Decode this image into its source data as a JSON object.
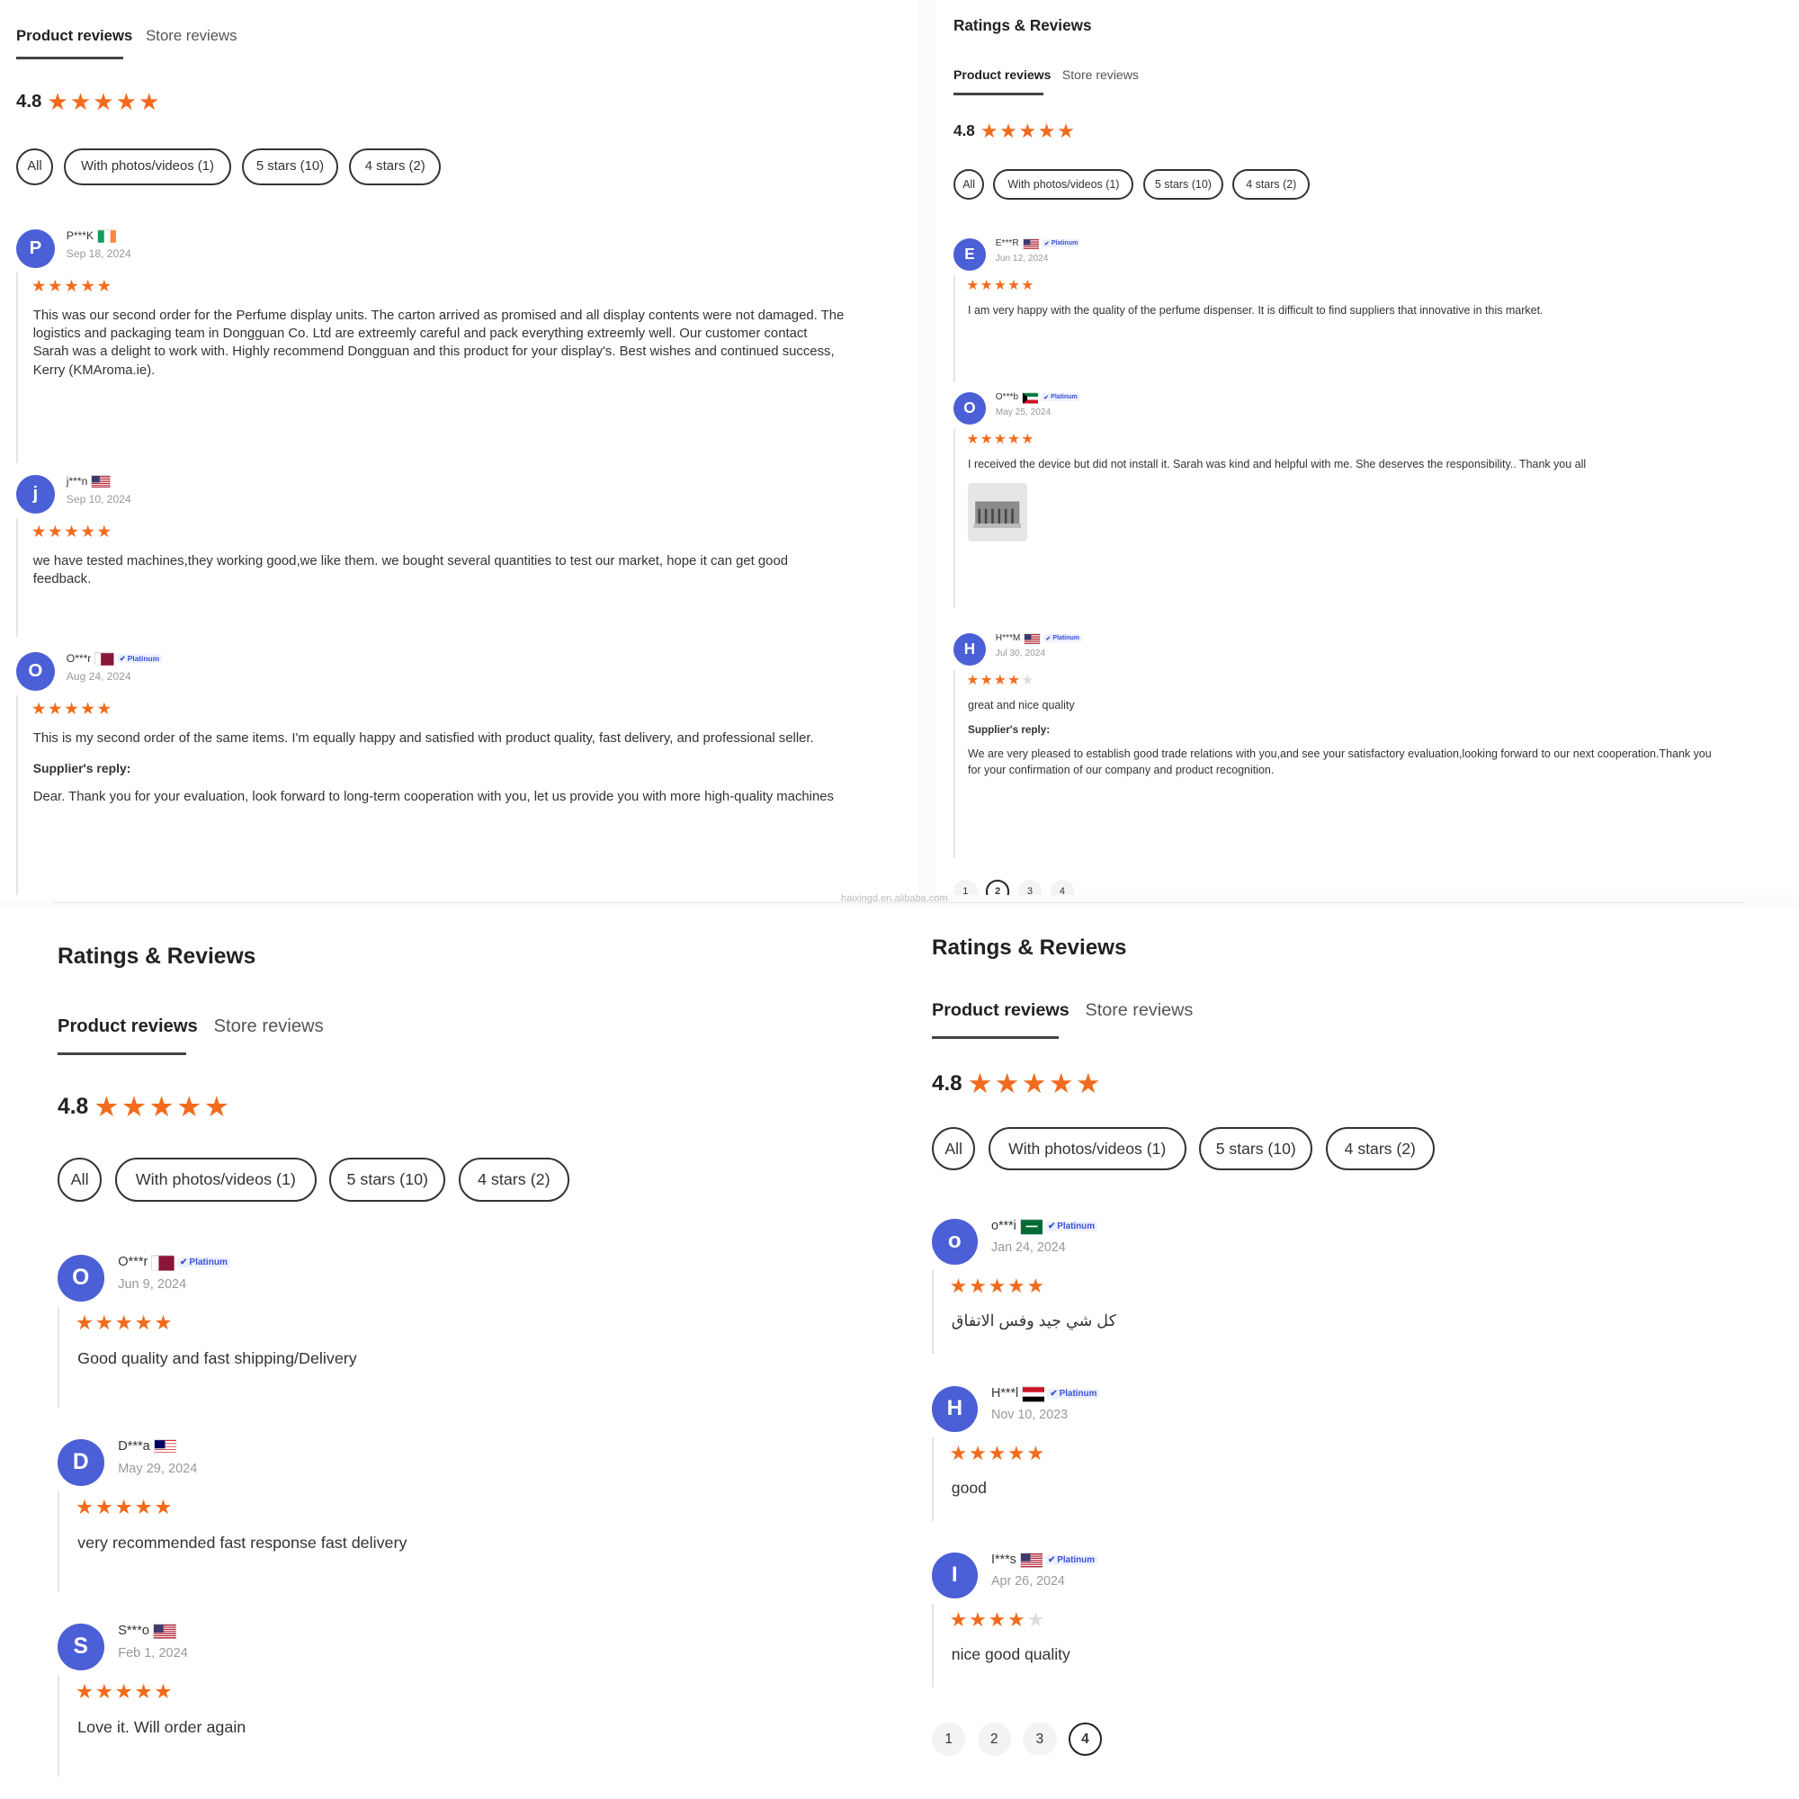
{
  "panels": [
    {
      "id": "p1",
      "title": "",
      "tabs": {
        "product": "Product reviews",
        "store": "Store reviews"
      },
      "rating": "4.8",
      "filters": [
        "All",
        "With photos/videos (1)",
        "5 stars (10)",
        "4 stars (2)"
      ],
      "reviews": [
        {
          "initial": "P",
          "name": "P***K",
          "flag": "ireland",
          "badge": "",
          "date": "Sep 18, 2024",
          "stars": 5,
          "text": "This was our second order for the Perfume display units. The carton arrived as promised and all display contents were not damaged. The logistics and packaging team in Dongguan Co. Ltd are extreemly careful and pack everything extreemly well. Our customer contact Sarah was a delight to work with. Highly recommend Dongguan and this product for your display's. Best wishes and continued success, Kerry (KMAroma.ie).",
          "reply_label": "",
          "reply": ""
        },
        {
          "initial": "j",
          "name": "j***n",
          "flag": "usa",
          "badge": "",
          "date": "Sep 10, 2024",
          "stars": 5,
          "text": "we have tested machines,they working good,we like them. we bought several quantities to test our market, hope it can get good feedback.",
          "reply_label": "",
          "reply": ""
        },
        {
          "initial": "O",
          "name": "O***r",
          "flag": "qatar",
          "badge": "Platinum",
          "date": "Aug 24, 2024",
          "stars": 5,
          "text": "This is my second order of the same items. I'm equally happy and satisfied with product quality, fast delivery, and professional seller.",
          "reply_label": "Supplier's reply:",
          "reply": "Dear. Thank you for your evaluation, look forward to long-term cooperation with you, let us provide you with more high-quality machines"
        }
      ],
      "pages": []
    },
    {
      "id": "p2",
      "title": "Ratings & Reviews",
      "tabs": {
        "product": "Product reviews",
        "store": "Store reviews"
      },
      "rating": "4.8",
      "filters": [
        "All",
        "With photos/videos (1)",
        "5 stars (10)",
        "4 stars (2)"
      ],
      "reviews": [
        {
          "initial": "E",
          "name": "E***R",
          "flag": "usa",
          "badge": "Platinum",
          "date": "Jun 12, 2024",
          "stars": 5,
          "text": "I am very happy with the quality of the perfume dispenser. It is difficult to find suppliers that innovative in this market.",
          "reply_label": "",
          "reply": ""
        },
        {
          "initial": "O",
          "name": "O***b",
          "flag": "kuwait",
          "badge": "Platinum",
          "date": "May 25, 2024",
          "stars": 5,
          "text": "I received the device but did not install it. Sarah was kind and helpful with me. She deserves the responsibility.. Thank you all",
          "reply_label": "",
          "reply": ""
        },
        {
          "initial": "H",
          "name": "H***M",
          "flag": "usa",
          "badge": "Platinum",
          "date": "Jul 30, 2024",
          "stars": 4,
          "text": "great and nice quality",
          "reply_label": "Supplier's reply:",
          "reply": "We are very pleased to establish good trade relations with you,and see your satisfactory evaluation,looking forward to our next cooperation.Thank you for your confirmation of our company and product recognition."
        }
      ],
      "pages": [
        "1",
        "2",
        "3",
        "4"
      ],
      "current_page": "2"
    },
    {
      "id": "p3",
      "title": "Ratings & Reviews",
      "tabs": {
        "product": "Product reviews",
        "store": "Store reviews"
      },
      "rating": "4.8",
      "filters": [
        "All",
        "With photos/videos (1)",
        "5 stars (10)",
        "4 stars (2)"
      ],
      "reviews": [
        {
          "initial": "O",
          "name": "O***r",
          "flag": "qatar",
          "badge": "Platinum",
          "date": "Jun 9, 2024",
          "stars": 5,
          "text": "Good quality and fast shipping/Delivery",
          "reply_label": "",
          "reply": ""
        },
        {
          "initial": "D",
          "name": "D***a",
          "flag": "malaysia",
          "badge": "",
          "date": "May 29, 2024",
          "stars": 5,
          "text": "very recommended fast response fast delivery",
          "reply_label": "",
          "reply": ""
        },
        {
          "initial": "S",
          "name": "S***o",
          "flag": "usa",
          "badge": "",
          "date": "Feb 1, 2024",
          "stars": 5,
          "text": "Love it. Will order again",
          "reply_label": "",
          "reply": ""
        }
      ],
      "pages": []
    },
    {
      "id": "p4",
      "title": "Ratings & Reviews",
      "tabs": {
        "product": "Product reviews",
        "store": "Store reviews"
      },
      "rating": "4.8",
      "filters": [
        "All",
        "With photos/videos (1)",
        "5 stars (10)",
        "4 stars (2)"
      ],
      "reviews": [
        {
          "initial": "o",
          "name": "o***i",
          "flag": "saudi",
          "badge": "Platinum",
          "date": "Jan 24, 2024",
          "stars": 5,
          "text": "كل شي جيد وفس الاتفاق",
          "reply_label": "",
          "reply": ""
        },
        {
          "initial": "H",
          "name": "H***l",
          "flag": "egypt",
          "badge": "Platinum",
          "date": "Nov 10, 2023",
          "stars": 5,
          "text": "good",
          "reply_label": "",
          "reply": ""
        },
        {
          "initial": "I",
          "name": "I***s",
          "flag": "usa",
          "badge": "Platinum",
          "date": "Apr 26, 2024",
          "stars": 4,
          "text": "nice good quality",
          "reply_label": "",
          "reply": ""
        }
      ],
      "pages": [
        "1",
        "2",
        "3",
        "4"
      ],
      "current_page": "4"
    }
  ],
  "watermark": "haixingd.en.alibaba.com",
  "colors": {
    "star": "#f26b1d",
    "avatar": "#4b5fd6",
    "badge": "#3b53d6"
  }
}
